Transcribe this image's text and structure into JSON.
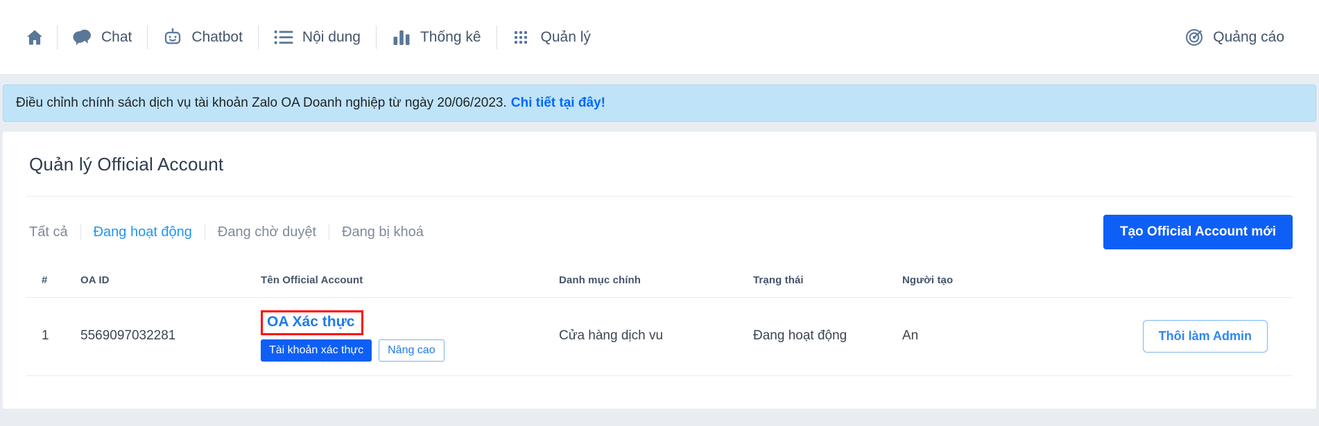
{
  "nav": {
    "left_items": [
      {
        "icon": "home-icon",
        "label": ""
      },
      {
        "icon": "chat-icon",
        "label": "Chat"
      },
      {
        "icon": "chatbot-icon",
        "label": "Chatbot"
      },
      {
        "icon": "content-list-icon",
        "label": "Nội dung"
      },
      {
        "icon": "bar-chart-icon",
        "label": "Thống kê"
      },
      {
        "icon": "grid-apps-icon",
        "label": "Quản lý"
      }
    ],
    "right_item": {
      "icon": "target-icon",
      "label": "Quảng cáo"
    }
  },
  "banner": {
    "text": "Điều chỉnh chính sách dịch vụ tài khoản Zalo OA Doanh nghiệp từ ngày 20/06/2023.",
    "link_text": "Chi tiết tại đây!",
    "background": "#bfe4fa",
    "link_color": "#0068ff"
  },
  "page": {
    "title": "Quản lý Official Account"
  },
  "filters": {
    "tabs": [
      {
        "label": "Tất cả",
        "active": false
      },
      {
        "label": "Đang hoạt động",
        "active": true
      },
      {
        "label": "Đang chờ duyệt",
        "active": false
      },
      {
        "label": "Đang bị khoá",
        "active": false
      }
    ],
    "create_button": "Tạo Official Account mới",
    "active_color": "#2196f3",
    "primary_color": "#0e5ff5"
  },
  "table": {
    "headers": {
      "index": "#",
      "oa_id": "OA ID",
      "name": "Tên Official Account",
      "category": "Danh mục chính",
      "status": "Trạng thái",
      "creator": "Người tạo",
      "actions": ""
    },
    "rows": [
      {
        "index": "1",
        "oa_id": "5569097032281",
        "name": "OA Xác thực",
        "badge_solid": "Tài khoản xác thực",
        "badge_outline": "Nâng cao",
        "category": "Cửa hàng dịch vu",
        "status": "Đang hoạt động",
        "creator": "An",
        "action_button": "Thôi làm Admin",
        "highlight_color": "#ff0000"
      }
    ]
  }
}
